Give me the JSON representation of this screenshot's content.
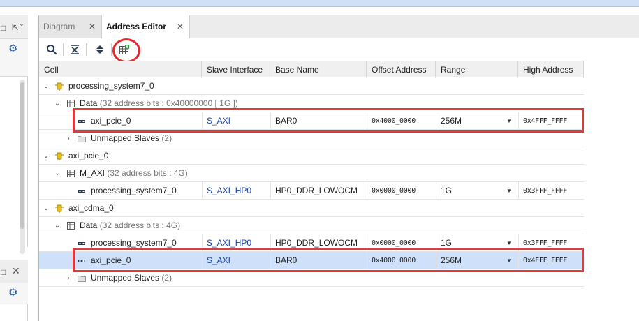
{
  "left_panel_top": {
    "restore_icon": "restore-window-icon",
    "popout_icon": "popout-icon",
    "gear_icon": "gear-icon"
  },
  "left_panel_bottom": {
    "restore_icon": "restore-window-icon",
    "close_icon": "close-icon",
    "gear_icon": "gear-icon"
  },
  "tabs": [
    {
      "label": "Diagram",
      "active": false
    },
    {
      "label": "Address Editor",
      "active": true
    }
  ],
  "toolbar": {
    "buttons": [
      "search-icon",
      "collapse-all-icon",
      "expand-all-icon",
      "auto-assign-address-icon"
    ]
  },
  "columns": [
    "Cell",
    "Slave Interface",
    "Base Name",
    "Offset Address",
    "Range",
    "High Address"
  ],
  "rows": [
    {
      "cell": "processing_system7_0",
      "level": 0,
      "type": "ip",
      "expanded": true
    },
    {
      "cell": "Data",
      "detail": "(32 address bits : 0x40000000 [ 1G ])",
      "level": 1,
      "type": "space",
      "expanded": true
    },
    {
      "cell": "axi_pcie_0",
      "level": 2,
      "type": "slave",
      "slave_interface": "S_AXI",
      "base_name": "BAR0",
      "offset": "0x4000_0000",
      "range": "256M",
      "high": "0x4FFF_FFFF"
    },
    {
      "cell": "Unmapped Slaves",
      "detail": "(2)",
      "level": 2,
      "type": "folder",
      "expanded": false
    },
    {
      "cell": "axi_pcie_0",
      "level": 0,
      "type": "ip",
      "expanded": true
    },
    {
      "cell": "M_AXI",
      "detail": "(32 address bits : 4G)",
      "level": 1,
      "type": "space",
      "expanded": true
    },
    {
      "cell": "processing_system7_0",
      "level": 2,
      "type": "slave",
      "slave_interface": "S_AXI_HP0",
      "base_name": "HP0_DDR_LOWOCM",
      "offset": "0x0000_0000",
      "range": "1G",
      "high": "0x3FFF_FFFF"
    },
    {
      "cell": "axi_cdma_0",
      "level": 0,
      "type": "ip",
      "expanded": true
    },
    {
      "cell": "Data",
      "detail": "(32 address bits : 4G)",
      "level": 1,
      "type": "space",
      "expanded": true
    },
    {
      "cell": "processing_system7_0",
      "level": 2,
      "type": "slave",
      "slave_interface": "S_AXI_HP0",
      "base_name": "HP0_DDR_LOWOCM",
      "offset": "0x0000_0000",
      "range": "1G",
      "high": "0x3FFF_FFFF"
    },
    {
      "cell": "axi_pcie_0",
      "level": 2,
      "type": "slave",
      "selected": true,
      "slave_interface": "S_AXI",
      "base_name": "BAR0",
      "offset": "0x4000_0000",
      "range": "256M",
      "high": "0x4FFF_FFFF"
    },
    {
      "cell": "Unmapped Slaves",
      "detail": "(2)",
      "level": 2,
      "type": "folder",
      "expanded": false
    }
  ],
  "colors": {
    "annotation_red": "#e03a3a",
    "link_blue": "#1a45b0",
    "selection": "#cfe0fa",
    "ip_yellow": "#e8c21a"
  }
}
